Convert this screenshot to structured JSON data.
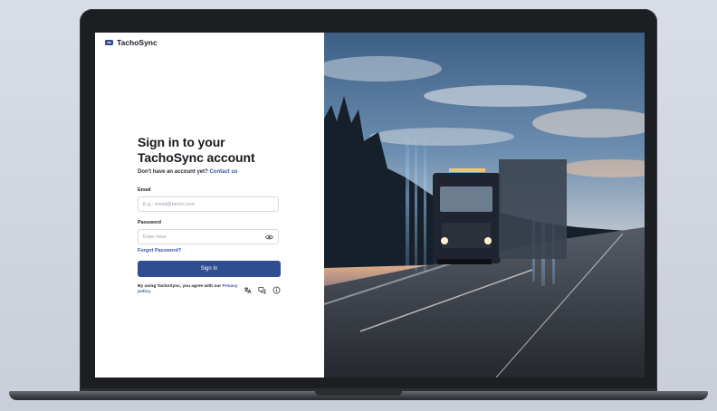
{
  "app": {
    "name": "TachoSync"
  },
  "form": {
    "title": "Sign in to your TachoSync account",
    "subtitle_text": "Don't have an account yet?",
    "contact_link": "Contact us",
    "email_label": "Email",
    "email_placeholder": "E.g.: email@tacho.com",
    "password_label": "Password",
    "password_placeholder": "Enter here",
    "forgot_link": "Forgot Password?",
    "signin_label": "Sign In",
    "agree_text": "By using TachoSync, you agree with our",
    "privacy_link": "Privacy policy."
  },
  "footer_icons": [
    "language-icon",
    "chat-icon",
    "info-icon"
  ],
  "colors": {
    "primary": "#2f4d91",
    "link": "#3a56a8"
  }
}
